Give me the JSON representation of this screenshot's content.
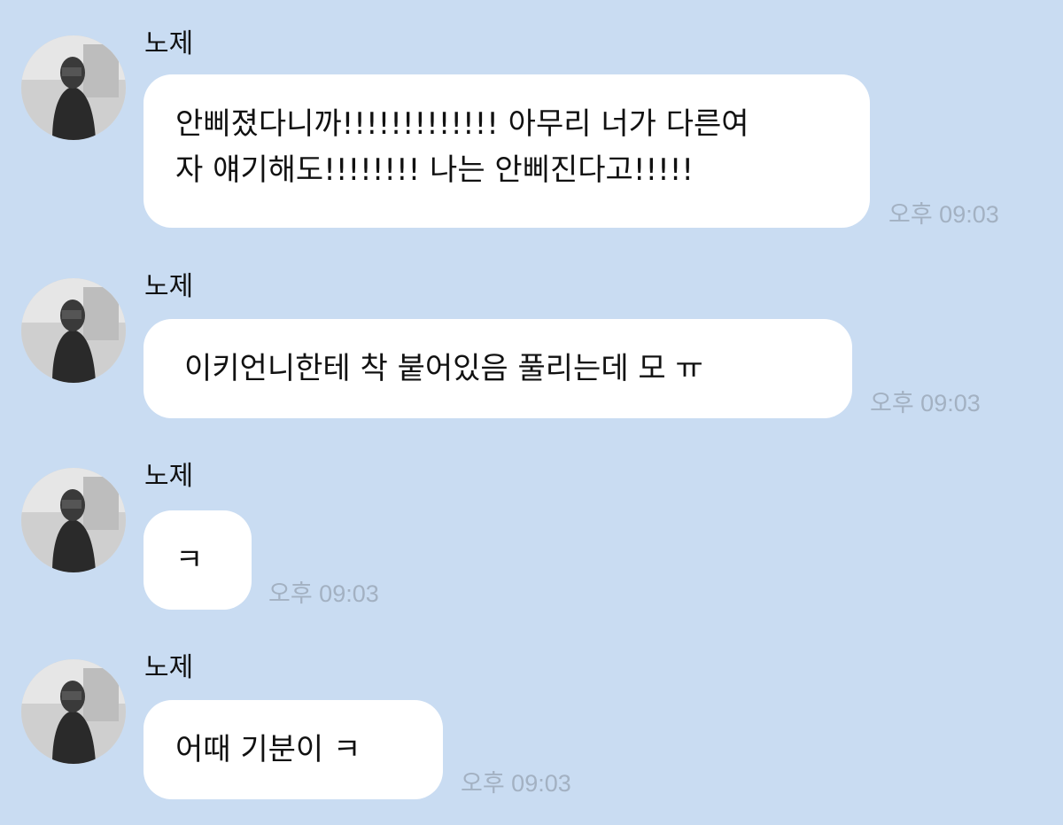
{
  "messages": [
    {
      "sender": "노제",
      "text": "안삐졌다니까!!!!!!!!!!!!! 아무리 너가 다른여\n자 얘기해도!!!!!!!! 나는 안삐진다고!!!!!",
      "time": "오후 09:03"
    },
    {
      "sender": "노제",
      "text": "이키언니한테 착 붙어있음 풀리는데 모 ㅠ",
      "time": "오후 09:03"
    },
    {
      "sender": "노제",
      "text": "ㅋ",
      "time": "오후 09:03"
    },
    {
      "sender": "노제",
      "text": "어때 기분이 ㅋ",
      "time": "오후 09:03"
    }
  ],
  "colors": {
    "background": "#c9dcf2",
    "bubble": "#ffffff",
    "timestamp": "#a3b1c2"
  }
}
